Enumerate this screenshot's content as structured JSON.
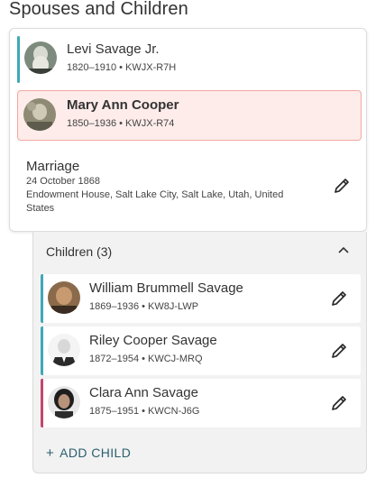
{
  "section_title": "Spouses and Children",
  "couple": {
    "husband": {
      "name": "Levi Savage Jr.",
      "meta": "1820–1910 • KWJX-R7H"
    },
    "wife": {
      "name": "Mary Ann Cooper",
      "meta": "1850–1936 • KWJX-R74"
    },
    "marriage": {
      "label": "Marriage",
      "date": "24 October 1868",
      "place": "Endowment House, Salt Lake City, Salt Lake, Utah, United States"
    }
  },
  "children": {
    "header": "Children (3)",
    "items": [
      {
        "name": "William Brummell Savage",
        "meta": "1869–1936 • KW8J-LWP",
        "gender_color": "#3fa8b8"
      },
      {
        "name": "Riley Cooper Savage",
        "meta": "1872–1954 • KWCJ-MRQ",
        "gender_color": "#3fa8b8"
      },
      {
        "name": "Clara Ann Savage",
        "meta": "1875–1951 • KWCN-J6G",
        "gender_color": "#c4466c"
      }
    ],
    "add_label": "ADD CHILD",
    "add_icon": "+"
  },
  "colors": {
    "male_bar": "#3fa8b8",
    "female_bar": "#c4466c",
    "highlight_bg": "#fdecea",
    "highlight_border": "#f2a8a2",
    "link": "#2b5f6e"
  }
}
